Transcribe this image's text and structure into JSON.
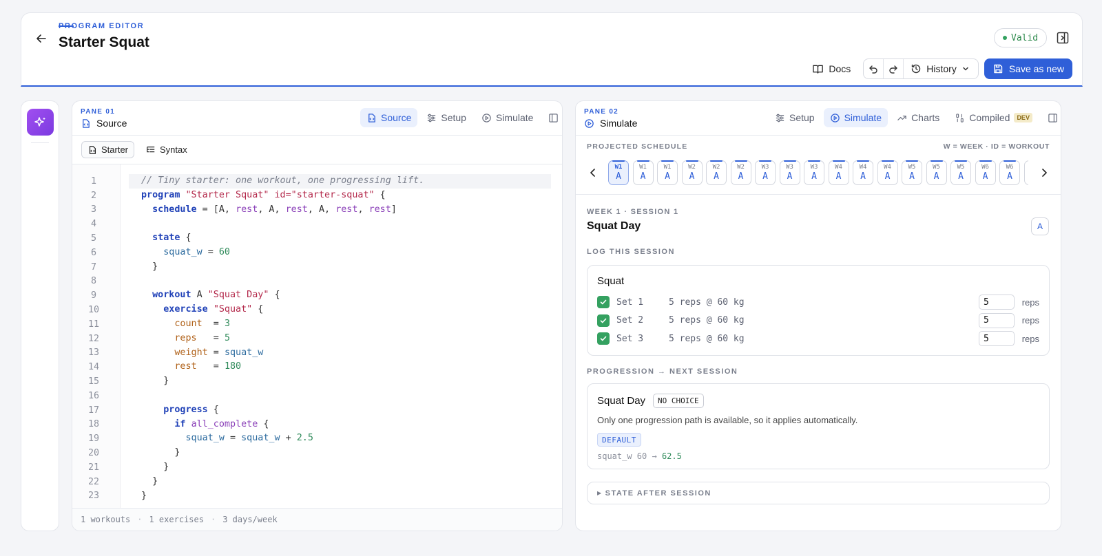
{
  "header": {
    "eyebrow": "PROGRAM EDITOR",
    "title": "Starter Squat",
    "status": "Valid",
    "docs_label": "Docs",
    "history_label": "History",
    "save_label": "Save as new"
  },
  "pane1": {
    "label": "PANE 01",
    "name": "Source",
    "tabs": [
      {
        "label": "Source",
        "active": true
      },
      {
        "label": "Setup"
      },
      {
        "label": "Simulate"
      }
    ],
    "subtabs": [
      {
        "label": "Starter"
      },
      {
        "label": "Syntax"
      }
    ],
    "code_lines": [
      [
        [
          "cm",
          "// Tiny starter: one workout, one progressing lift."
        ]
      ],
      [
        [
          "kw",
          "program "
        ],
        [
          "str",
          "\"Starter Squat\" "
        ],
        [
          "str",
          "id=\"starter-squat\""
        ],
        [
          "plain",
          " {"
        ]
      ],
      [
        [
          "plain",
          "  "
        ],
        [
          "kw",
          "schedule"
        ],
        [
          "plain",
          " = [A, "
        ],
        [
          "id",
          "rest"
        ],
        [
          "plain",
          ", A, "
        ],
        [
          "id",
          "rest"
        ],
        [
          "plain",
          ", A, "
        ],
        [
          "id",
          "rest"
        ],
        [
          "plain",
          ", "
        ],
        [
          "id",
          "rest"
        ],
        [
          "plain",
          "]"
        ]
      ],
      [
        [
          "plain",
          ""
        ]
      ],
      [
        [
          "plain",
          "  "
        ],
        [
          "kw",
          "state"
        ],
        [
          "plain",
          " {"
        ]
      ],
      [
        [
          "plain",
          "    "
        ],
        [
          "var",
          "squat_w"
        ],
        [
          "plain",
          " = "
        ],
        [
          "num",
          "60"
        ]
      ],
      [
        [
          "plain",
          "  }"
        ]
      ],
      [
        [
          "plain",
          ""
        ]
      ],
      [
        [
          "plain",
          "  "
        ],
        [
          "kw",
          "workout"
        ],
        [
          "plain",
          " A "
        ],
        [
          "str",
          "\"Squat Day\""
        ],
        [
          "plain",
          " {"
        ]
      ],
      [
        [
          "plain",
          "    "
        ],
        [
          "kw",
          "exercise"
        ],
        [
          "plain",
          " "
        ],
        [
          "str",
          "\"Squat\""
        ],
        [
          "plain",
          " {"
        ]
      ],
      [
        [
          "plain",
          "      "
        ],
        [
          "prop",
          "count"
        ],
        [
          "plain",
          "  = "
        ],
        [
          "num",
          "3"
        ]
      ],
      [
        [
          "plain",
          "      "
        ],
        [
          "prop",
          "reps"
        ],
        [
          "plain",
          "   = "
        ],
        [
          "num",
          "5"
        ]
      ],
      [
        [
          "plain",
          "      "
        ],
        [
          "prop",
          "weight"
        ],
        [
          "plain",
          " = "
        ],
        [
          "var",
          "squat_w"
        ]
      ],
      [
        [
          "plain",
          "      "
        ],
        [
          "prop",
          "rest"
        ],
        [
          "plain",
          "   = "
        ],
        [
          "num",
          "180"
        ]
      ],
      [
        [
          "plain",
          "    }"
        ]
      ],
      [
        [
          "plain",
          ""
        ]
      ],
      [
        [
          "plain",
          "    "
        ],
        [
          "kw",
          "progress"
        ],
        [
          "plain",
          " {"
        ]
      ],
      [
        [
          "plain",
          "      "
        ],
        [
          "kw",
          "if"
        ],
        [
          "plain",
          " "
        ],
        [
          "id",
          "all_complete"
        ],
        [
          "plain",
          " {"
        ]
      ],
      [
        [
          "plain",
          "        "
        ],
        [
          "var",
          "squat_w"
        ],
        [
          "plain",
          " = "
        ],
        [
          "var",
          "squat_w"
        ],
        [
          "plain",
          " + "
        ],
        [
          "num",
          "2.5"
        ]
      ],
      [
        [
          "plain",
          "      }"
        ]
      ],
      [
        [
          "plain",
          "    }"
        ]
      ],
      [
        [
          "plain",
          "  }"
        ]
      ],
      [
        [
          "plain",
          "}"
        ]
      ]
    ],
    "footer": [
      "1 workouts",
      "·",
      "1 exercises",
      "·",
      "3 days/week"
    ]
  },
  "pane2": {
    "label": "PANE 02",
    "name": "Simulate",
    "tabs": [
      {
        "label": "Setup"
      },
      {
        "label": "Simulate",
        "active": true
      },
      {
        "label": "Charts"
      },
      {
        "label": "Compiled"
      }
    ],
    "dev_badge": "DEV",
    "schedule_label": "PROJECTED SCHEDULE",
    "schedule_legend": "W = WEEK · ID = WORKOUT",
    "weeks": [
      {
        "w": "W1",
        "id": "A"
      },
      {
        "w": "W1",
        "id": "A"
      },
      {
        "w": "W1",
        "id": "A"
      },
      {
        "w": "W2",
        "id": "A"
      },
      {
        "w": "W2",
        "id": "A"
      },
      {
        "w": "W2",
        "id": "A"
      },
      {
        "w": "W3",
        "id": "A"
      },
      {
        "w": "W3",
        "id": "A"
      },
      {
        "w": "W3",
        "id": "A"
      },
      {
        "w": "W4",
        "id": "A"
      },
      {
        "w": "W4",
        "id": "A"
      },
      {
        "w": "W4",
        "id": "A"
      },
      {
        "w": "W5",
        "id": "A"
      },
      {
        "w": "W5",
        "id": "A"
      },
      {
        "w": "W5",
        "id": "A"
      },
      {
        "w": "W6",
        "id": "A"
      },
      {
        "w": "W6",
        "id": "A"
      }
    ],
    "session": {
      "eyebrow": "WEEK 1 · SESSION 1",
      "title": "Squat Day",
      "badge": "A",
      "log_label": "LOG THIS SESSION",
      "exercise": "Squat",
      "sets": [
        {
          "name": "Set 1",
          "desc": "5 reps @ 60 kg",
          "value": "5",
          "unit": "reps"
        },
        {
          "name": "Set 2",
          "desc": "5 reps @ 60 kg",
          "value": "5",
          "unit": "reps"
        },
        {
          "name": "Set 3",
          "desc": "5 reps @ 60 kg",
          "value": "5",
          "unit": "reps"
        }
      ],
      "progression_label": "PROGRESSION → NEXT SESSION",
      "progression": {
        "title": "Squat Day",
        "choice_badge": "NO CHOICE",
        "desc": "Only one progression path is available, so it applies automatically.",
        "path_badge": "DEFAULT",
        "from": "squat_w 60 →",
        "to": "62.5"
      },
      "state_label": "STATE AFTER SESSION"
    }
  }
}
